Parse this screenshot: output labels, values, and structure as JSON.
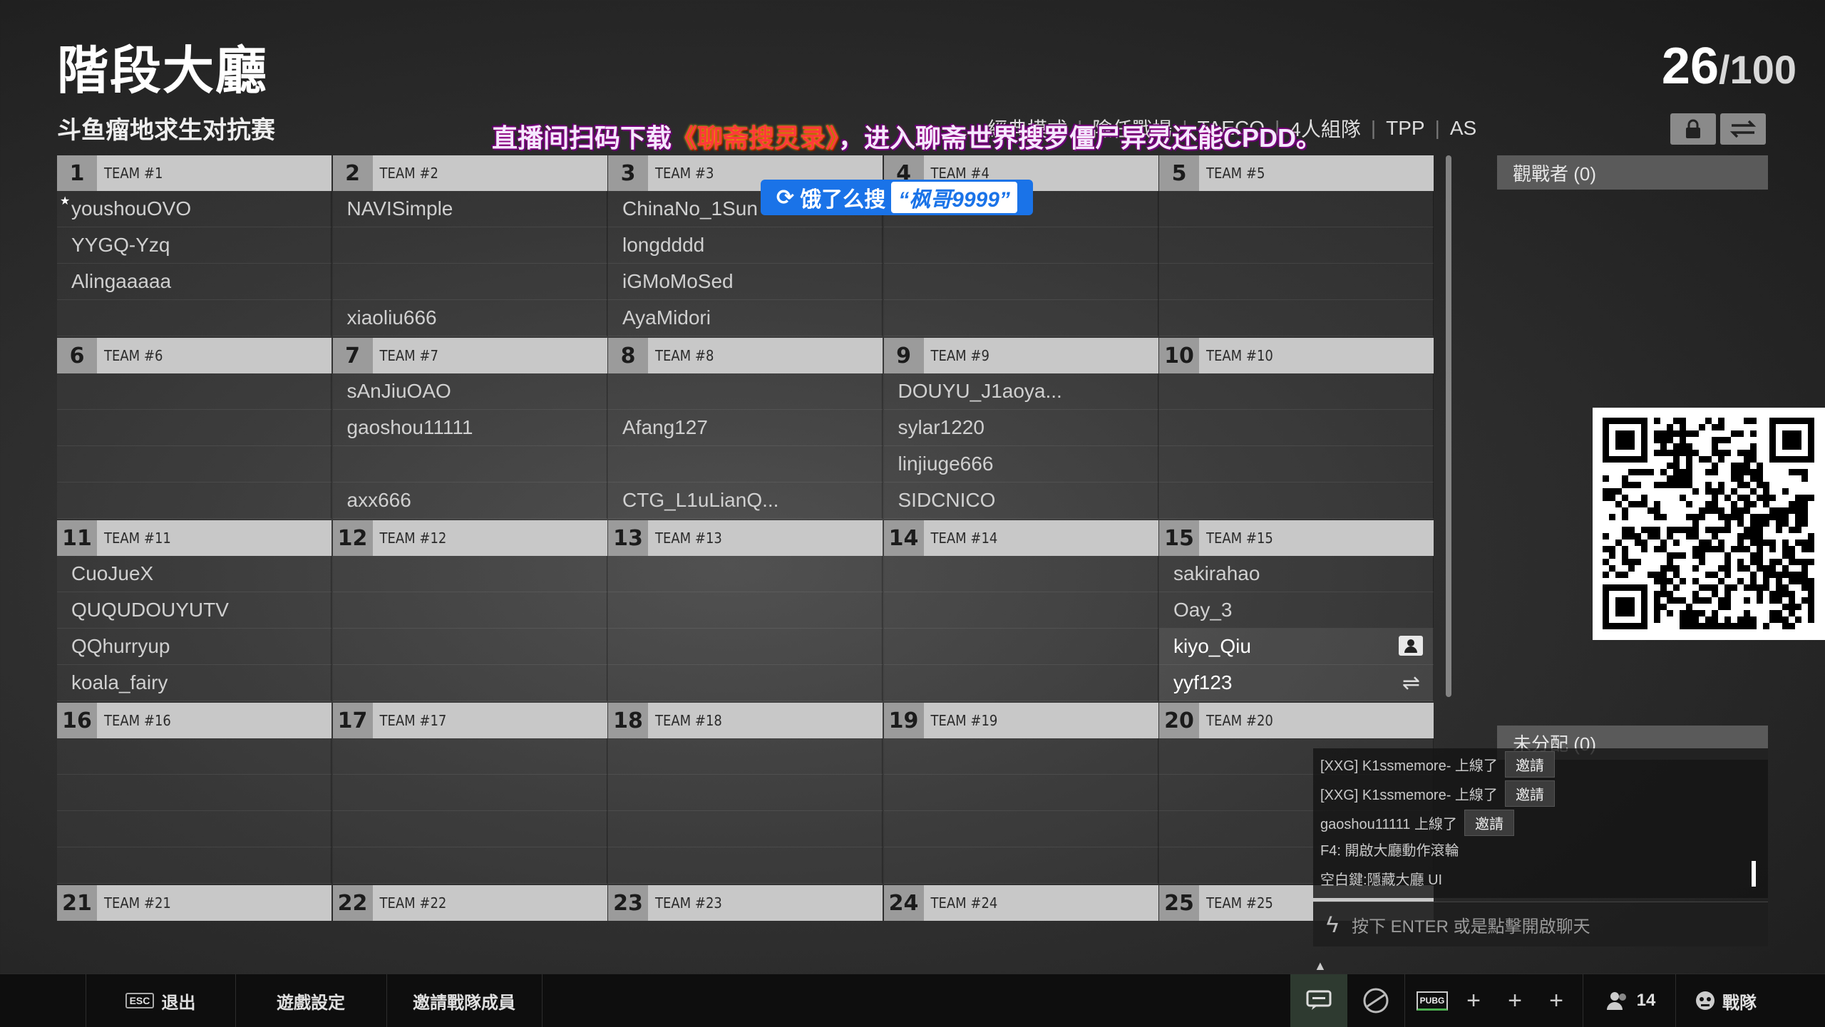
{
  "header": {
    "title": "階段大廳",
    "subtitle": "斗鱼瘤地求生对抗赛",
    "count_current": "26",
    "count_max": "/100",
    "mode_tags": [
      "經典模式",
      "險任戰場",
      "TAECO",
      "4人組隊",
      "TPP",
      "AS"
    ]
  },
  "overlay": {
    "promo_pre": "直播间扫码下载",
    "promo_title": "《聊斋搜灵录》",
    "promo_post": "，进入聊斋世界搜罗僵尸异灵还能CPDD。",
    "search_prefix": "饿了么搜",
    "search_query": "“枫哥9999”"
  },
  "side": {
    "spectators_label": "觀戰者 (0)",
    "unassigned_label": "未分配 (0)"
  },
  "teams": [
    {
      "num": "1",
      "name": "TEAM #1",
      "slots": [
        "youshouOVO",
        "YYGQ-Yzq",
        "Alingaaaaa",
        ""
      ]
    },
    {
      "num": "2",
      "name": "TEAM #2",
      "slots": [
        "NAVISimple",
        "",
        "",
        "xiaoliu666"
      ]
    },
    {
      "num": "3",
      "name": "TEAM #3",
      "slots": [
        "ChinaNo_1Sun",
        "longdddd",
        "iGMoMoSed",
        "AyaMidori"
      ]
    },
    {
      "num": "4",
      "name": "TEAM #4",
      "slots": [
        "",
        "",
        "",
        ""
      ]
    },
    {
      "num": "5",
      "name": "TEAM #5",
      "slots": [
        "",
        "",
        "",
        ""
      ]
    },
    {
      "num": "6",
      "name": "TEAM #6",
      "slots": [
        "",
        "",
        "",
        ""
      ]
    },
    {
      "num": "7",
      "name": "TEAM #7",
      "slots": [
        "sAnJiuOAO",
        "gaoshou11111",
        "",
        "axx666"
      ]
    },
    {
      "num": "8",
      "name": "TEAM #8",
      "slots": [
        "",
        "Afang127",
        "",
        "CTG_L1uLianQ..."
      ]
    },
    {
      "num": "9",
      "name": "TEAM #9",
      "slots": [
        "DOUYU_J1aoya...",
        "sylar1220",
        "linjiuge666",
        "SIDCNICO"
      ]
    },
    {
      "num": "10",
      "name": "TEAM #10",
      "slots": [
        "",
        "",
        "",
        ""
      ]
    },
    {
      "num": "11",
      "name": "TEAM #11",
      "slots": [
        "CuoJueX",
        "QUQUDOUYUTV",
        "QQhurryup",
        "koala_fairy"
      ]
    },
    {
      "num": "12",
      "name": "TEAM #12",
      "slots": [
        "",
        "",
        "",
        ""
      ]
    },
    {
      "num": "13",
      "name": "TEAM #13",
      "slots": [
        "",
        "",
        "",
        ""
      ]
    },
    {
      "num": "14",
      "name": "TEAM #14",
      "slots": [
        "",
        "",
        "",
        ""
      ]
    },
    {
      "num": "15",
      "name": "TEAM #15",
      "slots": [
        "sakirahao",
        "Oay_3",
        "kiyo_Qiu",
        "yyf123"
      ]
    },
    {
      "num": "16",
      "name": "TEAM #16",
      "slots": [
        "",
        "",
        "",
        ""
      ]
    },
    {
      "num": "17",
      "name": "TEAM #17",
      "slots": [
        "",
        "",
        "",
        ""
      ]
    },
    {
      "num": "18",
      "name": "TEAM #18",
      "slots": [
        "",
        "",
        "",
        ""
      ]
    },
    {
      "num": "19",
      "name": "TEAM #19",
      "slots": [
        "",
        "",
        "",
        ""
      ]
    },
    {
      "num": "20",
      "name": "TEAM #20",
      "slots": [
        "",
        "",
        "",
        ""
      ]
    },
    {
      "num": "21",
      "name": "TEAM #21",
      "slots": []
    },
    {
      "num": "22",
      "name": "TEAM #22",
      "slots": []
    },
    {
      "num": "23",
      "name": "TEAM #23",
      "slots": []
    },
    {
      "num": "24",
      "name": "TEAM #24",
      "slots": []
    },
    {
      "num": "25",
      "name": "TEAM #25",
      "slots": []
    }
  ],
  "chat": {
    "lines": [
      {
        "text": "[XXG] K1ssmemore- 上線了",
        "action": "邀請"
      },
      {
        "text": "[XXG] K1ssmemore- 上線了",
        "action": "邀請"
      },
      {
        "text": "gaoshou11111 上線了",
        "action": "邀請"
      },
      {
        "text": "F4: 開啟大廳動作滾輪",
        "action": ""
      },
      {
        "text": "空白鍵:隱藏大廳 UI",
        "action": ""
      }
    ],
    "input_placeholder": "按下 ENTER 或是點擊開啟聊天"
  },
  "bottom_bar": {
    "esc_key": "ESC",
    "exit_label": "退出",
    "settings_label": "遊戲設定",
    "invite_label": "邀請戰隊成員",
    "pubg_label": "PUBG",
    "friends_count": "14",
    "clan_label": "戰隊"
  }
}
